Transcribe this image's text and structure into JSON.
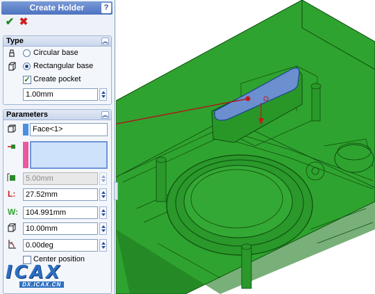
{
  "panel": {
    "title": "Create Holder",
    "help_glyph": "?",
    "ok_glyph": "✔",
    "cancel_glyph": "✖"
  },
  "type_group": {
    "header": "Type",
    "circular_label": "Circular base",
    "rectangular_label": "Rectangular base",
    "selected_base": "rectangular",
    "create_pocket_label": "Create pocket",
    "create_pocket_checked": true,
    "pocket_value": "1.00mm"
  },
  "parameters_group": {
    "header": "Parameters",
    "face_selection": "Face<1>",
    "face_swatch_color": "#4a90e2",
    "second_swatch_color": "#e85a9c",
    "second_selection": "",
    "disabled_value": "5.00mm",
    "length_label": "L:",
    "length_value": "27.52mm",
    "width_label": "W:",
    "width_value": "104.991mm",
    "height_value": "10.00mm",
    "angle_value": "0.00deg",
    "center_position_label": "Center position"
  },
  "watermark": {
    "logo": "ICAX",
    "subtitle": "DX.ICAX.CN"
  },
  "colors": {
    "model_green": "#2fa32f",
    "model_dark": "#0d4a0d",
    "selected_face": "#6f8fd8",
    "leader_line": "#a81c1c",
    "accent_blue": "#4d72c0"
  }
}
